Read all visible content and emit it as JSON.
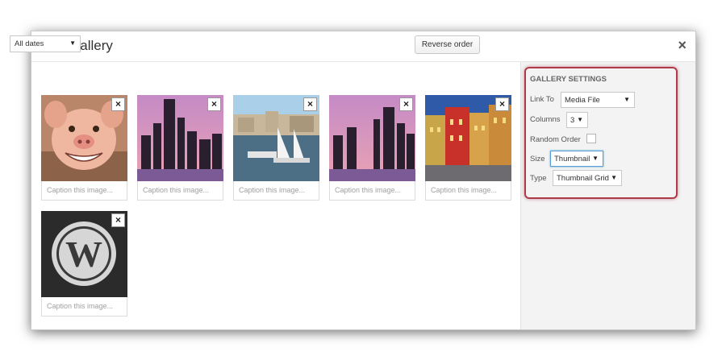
{
  "modal": {
    "title": "Edit Gallery",
    "close_symbol": "×"
  },
  "toolbar": {
    "date_filter": "All dates",
    "reverse_order": "Reverse order"
  },
  "images": [
    {
      "caption_placeholder": "Caption this image...",
      "remove_symbol": "×",
      "subject": "pig"
    },
    {
      "caption_placeholder": "Caption this image...",
      "remove_symbol": "×",
      "subject": "city-skyline-sunset"
    },
    {
      "caption_placeholder": "Caption this image...",
      "remove_symbol": "×",
      "subject": "harbor-boats"
    },
    {
      "caption_placeholder": "Caption this image...",
      "remove_symbol": "×",
      "subject": "city-skyline-sunset"
    },
    {
      "caption_placeholder": "Caption this image...",
      "remove_symbol": "×",
      "subject": "colorful-buildings"
    },
    {
      "caption_placeholder": "Caption this image...",
      "remove_symbol": "×",
      "subject": "wordpress-logo"
    }
  ],
  "settings": {
    "title": "GALLERY SETTINGS",
    "link_to": {
      "label": "Link To",
      "value": "Media File"
    },
    "columns": {
      "label": "Columns",
      "value": "3"
    },
    "random_order": {
      "label": "Random Order",
      "checked": false
    },
    "size": {
      "label": "Size",
      "value": "Thumbnail"
    },
    "type": {
      "label": "Type",
      "value": "Thumbnail Grid"
    }
  },
  "icons": {
    "dropdown_arrow": "▼"
  },
  "colors": {
    "highlight_border": "#b03a4a",
    "focus_border": "#5b9dd9"
  }
}
